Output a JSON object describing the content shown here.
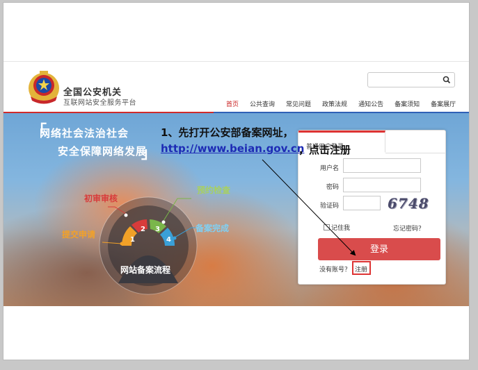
{
  "header": {
    "site_name": "全国公安机关",
    "site_sub": "互联网站安全服务平台",
    "search_placeholder": ""
  },
  "nav": {
    "items": [
      {
        "label": "首页",
        "active": true
      },
      {
        "label": "公共查询",
        "active": false
      },
      {
        "label": "常见问题",
        "active": false
      },
      {
        "label": "政策法规",
        "active": false
      },
      {
        "label": "通知公告",
        "active": false
      },
      {
        "label": "备案须知",
        "active": false
      },
      {
        "label": "备案展厅",
        "active": false
      }
    ]
  },
  "banner": {
    "slogan_1": "网络社会法治社会",
    "slogan_2": "安全保障网络发展",
    "flow_title": "网站备案流程",
    "steps": [
      {
        "label": "提交申请",
        "num": "1",
        "color": "#f2a128"
      },
      {
        "label": "初审审核",
        "num": "2",
        "color": "#d83b3b"
      },
      {
        "label": "预约检查",
        "num": "3",
        "color": "#7ab64a"
      },
      {
        "label": "备案完成",
        "num": "4",
        "color": "#3aa0d8"
      }
    ]
  },
  "login": {
    "tab_label": "普通用户登录",
    "username_label": "用户名",
    "password_label": "密码",
    "captcha_label": "验证码",
    "captcha_text": "6748",
    "remember_label": "记住我",
    "forgot_label": "忘记密码？",
    "login_button": "登录",
    "no_account": "没有账号？",
    "register_label": "注册"
  },
  "annotation": {
    "line1": "1、先打开公安部备案网址，",
    "url": "http://www.beian.gov.cn",
    "line2": "，点击注册"
  },
  "colors": {
    "accent_red": "#d94c4c",
    "nav_active": "#c81e1e",
    "link_blue": "#1d2bb5"
  }
}
